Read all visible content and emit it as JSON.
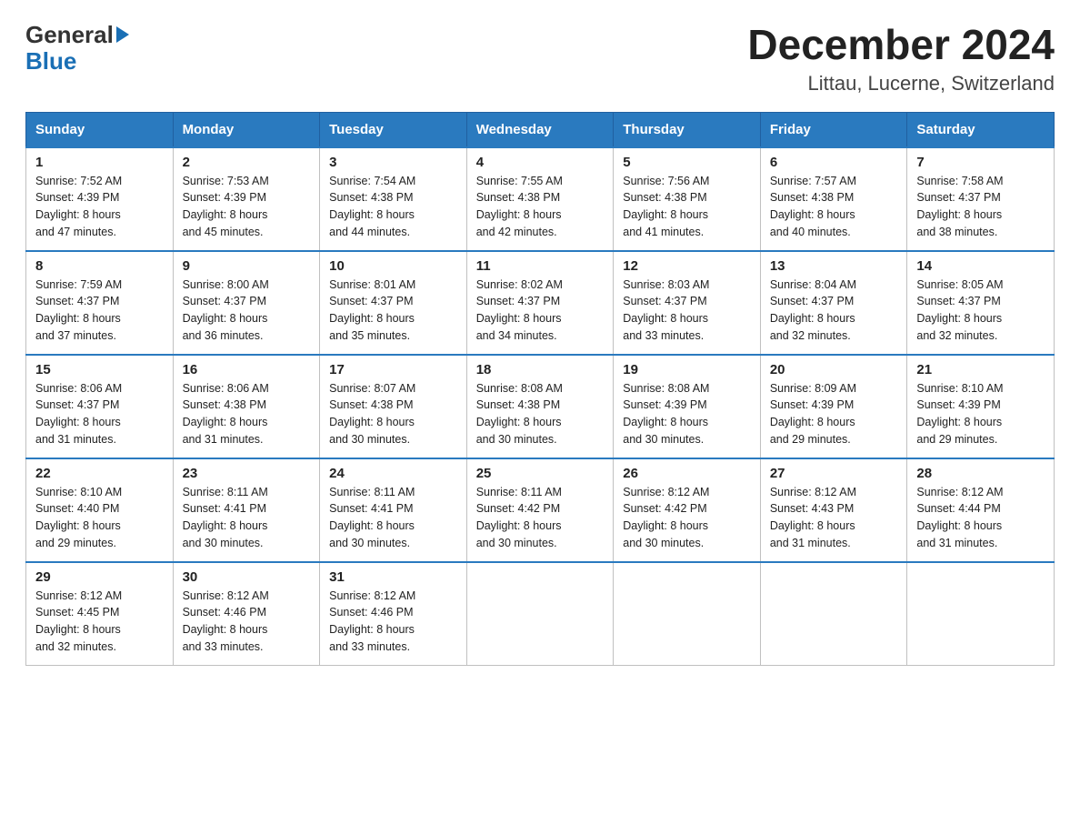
{
  "logo": {
    "general": "General",
    "blue": "Blue"
  },
  "title": "December 2024",
  "subtitle": "Littau, Lucerne, Switzerland",
  "days_of_week": [
    "Sunday",
    "Monday",
    "Tuesday",
    "Wednesday",
    "Thursday",
    "Friday",
    "Saturday"
  ],
  "weeks": [
    [
      {
        "day": "1",
        "sunrise": "7:52 AM",
        "sunset": "4:39 PM",
        "daylight": "8 hours and 47 minutes."
      },
      {
        "day": "2",
        "sunrise": "7:53 AM",
        "sunset": "4:39 PM",
        "daylight": "8 hours and 45 minutes."
      },
      {
        "day": "3",
        "sunrise": "7:54 AM",
        "sunset": "4:38 PM",
        "daylight": "8 hours and 44 minutes."
      },
      {
        "day": "4",
        "sunrise": "7:55 AM",
        "sunset": "4:38 PM",
        "daylight": "8 hours and 42 minutes."
      },
      {
        "day": "5",
        "sunrise": "7:56 AM",
        "sunset": "4:38 PM",
        "daylight": "8 hours and 41 minutes."
      },
      {
        "day": "6",
        "sunrise": "7:57 AM",
        "sunset": "4:38 PM",
        "daylight": "8 hours and 40 minutes."
      },
      {
        "day": "7",
        "sunrise": "7:58 AM",
        "sunset": "4:37 PM",
        "daylight": "8 hours and 38 minutes."
      }
    ],
    [
      {
        "day": "8",
        "sunrise": "7:59 AM",
        "sunset": "4:37 PM",
        "daylight": "8 hours and 37 minutes."
      },
      {
        "day": "9",
        "sunrise": "8:00 AM",
        "sunset": "4:37 PM",
        "daylight": "8 hours and 36 minutes."
      },
      {
        "day": "10",
        "sunrise": "8:01 AM",
        "sunset": "4:37 PM",
        "daylight": "8 hours and 35 minutes."
      },
      {
        "day": "11",
        "sunrise": "8:02 AM",
        "sunset": "4:37 PM",
        "daylight": "8 hours and 34 minutes."
      },
      {
        "day": "12",
        "sunrise": "8:03 AM",
        "sunset": "4:37 PM",
        "daylight": "8 hours and 33 minutes."
      },
      {
        "day": "13",
        "sunrise": "8:04 AM",
        "sunset": "4:37 PM",
        "daylight": "8 hours and 32 minutes."
      },
      {
        "day": "14",
        "sunrise": "8:05 AM",
        "sunset": "4:37 PM",
        "daylight": "8 hours and 32 minutes."
      }
    ],
    [
      {
        "day": "15",
        "sunrise": "8:06 AM",
        "sunset": "4:37 PM",
        "daylight": "8 hours and 31 minutes."
      },
      {
        "day": "16",
        "sunrise": "8:06 AM",
        "sunset": "4:38 PM",
        "daylight": "8 hours and 31 minutes."
      },
      {
        "day": "17",
        "sunrise": "8:07 AM",
        "sunset": "4:38 PM",
        "daylight": "8 hours and 30 minutes."
      },
      {
        "day": "18",
        "sunrise": "8:08 AM",
        "sunset": "4:38 PM",
        "daylight": "8 hours and 30 minutes."
      },
      {
        "day": "19",
        "sunrise": "8:08 AM",
        "sunset": "4:39 PM",
        "daylight": "8 hours and 30 minutes."
      },
      {
        "day": "20",
        "sunrise": "8:09 AM",
        "sunset": "4:39 PM",
        "daylight": "8 hours and 29 minutes."
      },
      {
        "day": "21",
        "sunrise": "8:10 AM",
        "sunset": "4:39 PM",
        "daylight": "8 hours and 29 minutes."
      }
    ],
    [
      {
        "day": "22",
        "sunrise": "8:10 AM",
        "sunset": "4:40 PM",
        "daylight": "8 hours and 29 minutes."
      },
      {
        "day": "23",
        "sunrise": "8:11 AM",
        "sunset": "4:41 PM",
        "daylight": "8 hours and 30 minutes."
      },
      {
        "day": "24",
        "sunrise": "8:11 AM",
        "sunset": "4:41 PM",
        "daylight": "8 hours and 30 minutes."
      },
      {
        "day": "25",
        "sunrise": "8:11 AM",
        "sunset": "4:42 PM",
        "daylight": "8 hours and 30 minutes."
      },
      {
        "day": "26",
        "sunrise": "8:12 AM",
        "sunset": "4:42 PM",
        "daylight": "8 hours and 30 minutes."
      },
      {
        "day": "27",
        "sunrise": "8:12 AM",
        "sunset": "4:43 PM",
        "daylight": "8 hours and 31 minutes."
      },
      {
        "day": "28",
        "sunrise": "8:12 AM",
        "sunset": "4:44 PM",
        "daylight": "8 hours and 31 minutes."
      }
    ],
    [
      {
        "day": "29",
        "sunrise": "8:12 AM",
        "sunset": "4:45 PM",
        "daylight": "8 hours and 32 minutes."
      },
      {
        "day": "30",
        "sunrise": "8:12 AM",
        "sunset": "4:46 PM",
        "daylight": "8 hours and 33 minutes."
      },
      {
        "day": "31",
        "sunrise": "8:12 AM",
        "sunset": "4:46 PM",
        "daylight": "8 hours and 33 minutes."
      },
      null,
      null,
      null,
      null
    ]
  ],
  "labels": {
    "sunrise": "Sunrise:",
    "sunset": "Sunset:",
    "daylight": "Daylight:"
  }
}
